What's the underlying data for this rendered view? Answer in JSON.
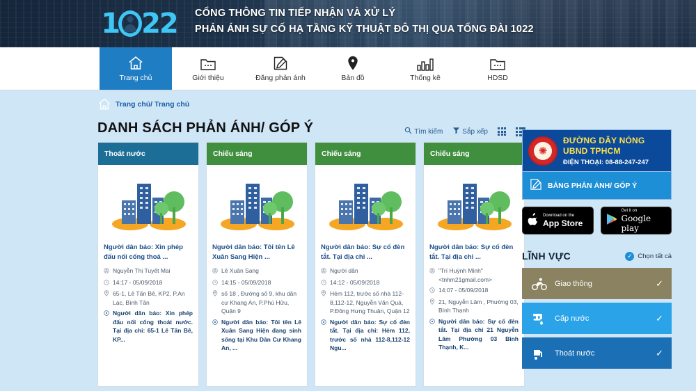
{
  "header": {
    "logo_text_1": "1",
    "logo_text_2": "22",
    "logo_icon": "operator-headset-icon",
    "title_line1": "CỔNG THÔNG TIN TIẾP NHẬN VÀ XỬ LÝ",
    "title_line2": "PHẢN ÁNH SỰ CỐ HẠ TẦNG KỸ THUẬT ĐÔ THỊ QUA TỔNG ĐÀI 1022"
  },
  "nav": {
    "items": [
      {
        "label": "Trang chủ",
        "icon": "home-icon",
        "active": true
      },
      {
        "label": "Giới thiệu",
        "icon": "folder-icon",
        "active": false
      },
      {
        "label": "Đăng phản ánh",
        "icon": "edit-note-icon",
        "active": false
      },
      {
        "label": "Bản đồ",
        "icon": "map-pin-icon",
        "active": false
      },
      {
        "label": "Thống kê",
        "icon": "bar-chart-icon",
        "active": false
      },
      {
        "label": "HDSD",
        "icon": "folder-icon",
        "active": false
      }
    ]
  },
  "breadcrumb": {
    "icon": "home-outline-icon",
    "text": "Trang chủ/ Trang chủ"
  },
  "main": {
    "page_title": "DANH SÁCH PHẢN ÁNH/ GÓP Ý",
    "tools": {
      "search_label": "Tìm kiếm",
      "search_icon": "search-icon",
      "sort_label": "Sắp xếp",
      "sort_icon": "filter-icon",
      "grid_view_icon": "grid-view-icon",
      "list_view_icon": "list-view-icon"
    },
    "cards": [
      {
        "category": "Thoát nước",
        "category_color": "#1c6e96",
        "title": "Người dân báo: Xin phép đấu nối cống thoá ...",
        "reporter": "Nguyễn Thị Tuyết Mai",
        "time": "14:17 - 05/09/2018",
        "address": "65-1, Lê Tấn Bê, KP2, P.An Lạc, Bình Tân",
        "description": "Người dân báo: Xin phép đấu nối cống thoát nước. Tại địa chỉ: 65-1 Lê Tấn Bê, KP..."
      },
      {
        "category": "Chiếu sáng",
        "category_color": "#3f8f3f",
        "title": "Người dân báo: Tôi tên Lê Xuân Sang Hiện ...",
        "reporter": "Lê Xuân Sang",
        "time": "14:15 - 05/09/2018",
        "address": "số 18 , Đường số 9, khu dân cư Khang An, P.Phú Hữu, Quận 9",
        "description": "Người dân báo: Tôi tên Lê Xuân Sang Hiện đang sinh sống tại Khu Dân Cư Khang An, ..."
      },
      {
        "category": "Chiếu sáng",
        "category_color": "#3f8f3f",
        "title": "Người dân báo: Sự cố đèn tắt. Tại địa chỉ ...",
        "reporter": "Người dân",
        "time": "14:12 - 05/09/2018",
        "address": "Hẻm 112, trước số nhà 112-8,112-12, Nguyễn Văn Quá, P.Đông Hưng Thuận, Quận 12",
        "description": "Người dân báo: Sự cố đèn tắt. Tại địa chỉ: Hẻm 112, trước số nhà 112-8,112-12 Ngu..."
      },
      {
        "category": "Chiếu sáng",
        "category_color": "#3f8f3f",
        "title": "Người dân báo: Sự cố đèn tắt. Tại địa chỉ ...",
        "reporter": "\"Trí Huỳnh Minh\" <tnhm21gmail.com>",
        "time": "14:07 - 05/09/2018",
        "address": "21, Nguyễn Lâm , Phường 03, Bình Thạnh",
        "description": "Người dân báo: Sự cố đèn tắt. Tại địa chỉ 21 Nguyễn Lâm Phường 03 Bình Thạnh, K..."
      }
    ]
  },
  "sidebar": {
    "hotline": {
      "seal_icon": "emblem-icon",
      "line1": "ĐƯỜNG DÂY NÓNG",
      "line2": "UBND TPHCM",
      "phone_label": "ĐIỆN THOẠI: 08-88-247-247"
    },
    "report_button": {
      "icon": "edit-note-icon",
      "label": "BẢNG PHẢN ÁNH/ GÓP Ý"
    },
    "stores": [
      {
        "icon": "apple-icon",
        "top": "Download on the",
        "bottom": "App Store"
      },
      {
        "icon": "google-play-icon",
        "top": "Get it on",
        "bottom": "Google play"
      }
    ],
    "fields": {
      "title": "LĨNH VỰC",
      "select_all_label": "Chọn tất cả",
      "select_all_icon": "check-circle-icon",
      "categories": [
        {
          "label": "Giao thông",
          "icon": "motorbike-icon",
          "color": "#8a8260",
          "checked": true,
          "check_glyph": "✓"
        },
        {
          "label": "Cấp nước",
          "icon": "faucet-icon",
          "color": "#2aa3e8",
          "checked": true,
          "check_glyph": "✓"
        },
        {
          "label": "Thoát nước",
          "icon": "drain-icon",
          "color": "#1a6fb5",
          "checked": true,
          "check_glyph": "✓"
        }
      ]
    }
  },
  "colors": {
    "page_bg": "#cfe6f7",
    "header_bg": "#16273d",
    "nav_active": "#1f7dc4",
    "accent": "#1d8fd6"
  }
}
